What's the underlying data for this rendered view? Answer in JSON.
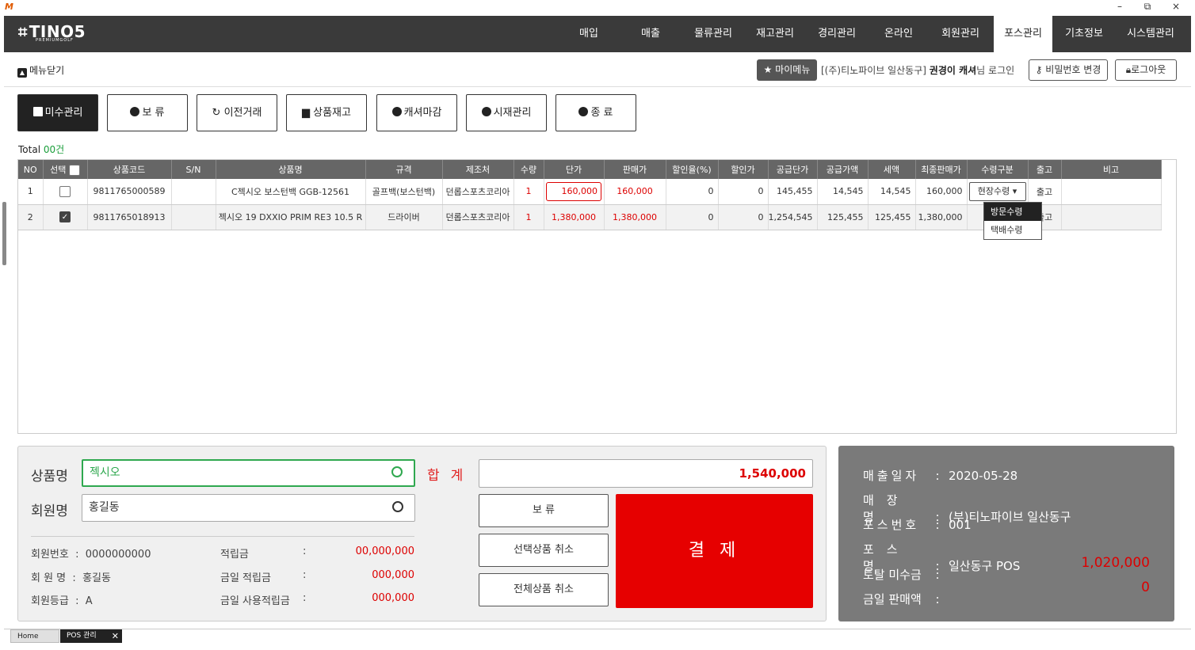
{
  "window": {
    "minimize": "–",
    "restore": "⧉",
    "close": "×"
  },
  "brand": {
    "name": "TINO5",
    "sub": "PREMIUMGOLF"
  },
  "nav": [
    "매입",
    "매출",
    "물류관리",
    "재고관리",
    "경리관리",
    "온라인",
    "회원관리",
    "포스관리",
    "기초정보",
    "시스템관리"
  ],
  "nav_active": "포스관리",
  "subbar": {
    "menu_close": "메뉴닫기",
    "my_menu": "마이메뉴",
    "login_prefix": "[(주)티노파이브 일산동구]",
    "login_user": "권경이 캐셔",
    "login_suffix": "님 로그인",
    "change_password": "비밀번호 변경",
    "logout": "로그아웃"
  },
  "toolbar": [
    {
      "label": "미수관리",
      "icon": "ledger-icon"
    },
    {
      "label": "보 류",
      "icon": "minus-circle-icon"
    },
    {
      "label": "이전거래",
      "icon": "undo-icon"
    },
    {
      "label": "상품재고",
      "icon": "save-icon"
    },
    {
      "label": "캐셔마감",
      "icon": "list-circle-icon"
    },
    {
      "label": "시재관리",
      "icon": "won-circle-icon"
    },
    {
      "label": "종 료",
      "icon": "close-circle-icon"
    }
  ],
  "total": {
    "label": "Total",
    "count": "00건"
  },
  "table": {
    "headers": [
      "NO",
      "선택",
      "상품코드",
      "S/N",
      "상품명",
      "규격",
      "제조처",
      "수량",
      "단가",
      "판매가",
      "할인율(%)",
      "할인가",
      "공급단가",
      "공급가액",
      "세액",
      "최종판매가",
      "수령구분",
      "출고",
      "비고"
    ],
    "rows": [
      {
        "no": "1",
        "checked": false,
        "code": "9811765000589",
        "sn": "",
        "name": "C젝시오 보스턴백 GGB-12561",
        "spec": "골프백(보스턴백)",
        "maker": "던롭스포츠코리아",
        "qty": "1",
        "unit_price": "160,000",
        "sale_price": "160,000",
        "discount_rate": "0",
        "discount_price": "0",
        "supply_unit": "145,455",
        "supply_amount": "14,545",
        "tax": "14,545",
        "final_price": "160,000",
        "receive": "현장수령",
        "out": "출고",
        "note": ""
      },
      {
        "no": "2",
        "checked": true,
        "code": "9811765018913",
        "sn": "",
        "name": "젝시오 19 DXXIO PRIM RE3 10.5 R",
        "spec": "드라이버",
        "maker": "던롭스포츠코리아",
        "qty": "1",
        "unit_price": "1,380,000",
        "sale_price": "1,380,000",
        "discount_rate": "0",
        "discount_price": "0",
        "supply_unit": "1,254,545",
        "supply_amount": "125,455",
        "tax": "125,455",
        "final_price": "1,380,000",
        "receive": "",
        "out": "출고",
        "note": ""
      }
    ],
    "receive_options": [
      "방문수령",
      "택배수령"
    ],
    "receive_selected": "방문수령"
  },
  "left_panel": {
    "product_label": "상품명",
    "product_value": "젝시오",
    "member_label": "회원명",
    "member_value": "홍길동",
    "sum_label": "합계",
    "sum_value": "1,540,000",
    "hold_btn": "보 류",
    "cancel_selected_btn": "선택상품 취소",
    "cancel_all_btn": "전체상품 취소",
    "pay_btn": "결 제",
    "member_no_label": "회원번호",
    "member_no_value": "0000000000",
    "member_name_label": "회 원 명",
    "member_name_value": "홍길동",
    "member_grade_label": "회원등급",
    "member_grade_value": "A",
    "points_label": "적립금",
    "points_value": "00,000,000",
    "today_points_label": "금일 적립금",
    "today_points_value": "000,000",
    "today_used_label": "금일 사용적립금",
    "today_used_value": "000,000"
  },
  "right_panel": {
    "sale_date_label": "매출일자",
    "sale_date_value": "2020-05-28",
    "store_label": "매장명",
    "store_value": "(부)티노파이브 일산동구",
    "pos_no_label": "포스번호",
    "pos_no_value": "001",
    "pos_name_label": "포스명",
    "pos_name_value": "일산동구 POS",
    "total_unpaid_label": "토탈 미수금",
    "total_unpaid_value": "1,020,000",
    "today_sales_label": "금일 판매액",
    "today_sales_value": "0"
  },
  "bottom_tabs": {
    "home": "Home",
    "pos": "POS 관리",
    "close": "✕"
  },
  "colors": {
    "accent_red": "#e60000",
    "nav_bg": "#3a3a3a",
    "green": "#2fa84f"
  }
}
